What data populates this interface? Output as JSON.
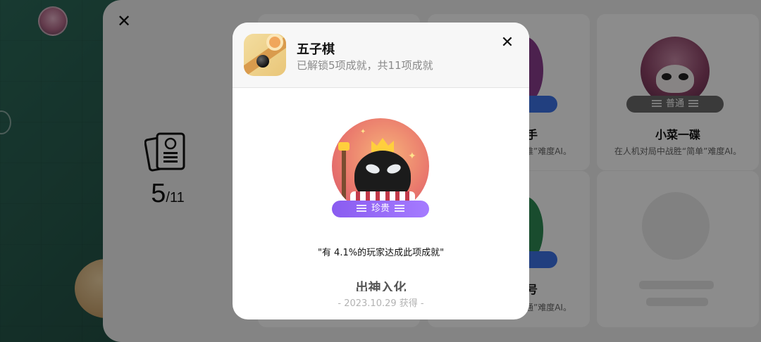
{
  "panel": {
    "close_glyph": "✕",
    "progress": {
      "unlocked": "5",
      "total": "/11"
    }
  },
  "cards": [
    {
      "tier": "普通",
      "title": "小菜一碟",
      "desc": "在人机对局中战胜“简单”难度AI。"
    },
    {
      "partial_title": "手",
      "partial_desc": "难”难度AI。"
    },
    {
      "partial_title": "号",
      "partial_desc": "通”难度AI。"
    }
  ],
  "modal": {
    "game_title": "五子棋",
    "subtitle": "已解锁5项成就，共11项成就",
    "close_glyph": "✕",
    "rarity": "珍贵",
    "player_stat": "\"有 4.1%的玩家达成此项成就\"",
    "achievement_name": "出神入化",
    "unlock_date": "- 2023.10.29 获得 -"
  },
  "colors": {
    "rarity_purple": "#8a5cf0",
    "tier_gray": "#6b6b6b",
    "badge_blue": "#3d74e8"
  },
  "icons": [
    "close-icon",
    "achievement-book-icon",
    "gomoku-game-icon",
    "king-stone-badge-icon"
  ]
}
